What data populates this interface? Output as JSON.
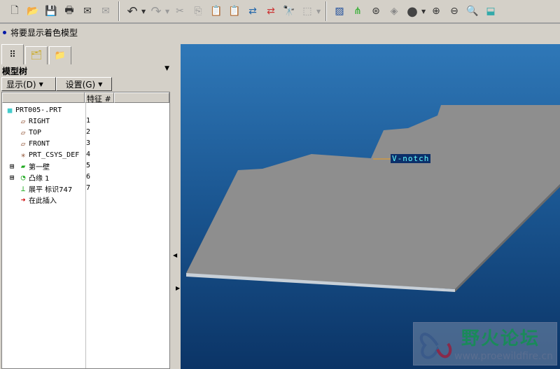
{
  "toolbar": {
    "icons": [
      "new-icon",
      "open-icon",
      "save-icon",
      "print-icon",
      "email-icon",
      "email-link-icon",
      "undo-icon",
      "redo-icon",
      "cut-icon",
      "copy-icon",
      "paste-icon",
      "paste-special-icon",
      "regenerate-icon",
      "regen-manager-icon",
      "find-icon",
      "select-box-icon",
      "datum-display-icon",
      "axis-icon",
      "csys-icon",
      "spin-icon",
      "shading-icon",
      "zoom-in-icon",
      "zoom-out-icon",
      "refit-icon",
      "reorient-icon"
    ]
  },
  "message": "将要显示着色模型",
  "panel": {
    "title": "模型树",
    "show_label": "显示(D)",
    "settings_label": "设置(G)",
    "col_feature": "特征 #"
  },
  "tree": [
    {
      "label": "PRT005-.PRT",
      "num": ""
    },
    {
      "label": "RIGHT",
      "num": "1"
    },
    {
      "label": "TOP",
      "num": "2"
    },
    {
      "label": "FRONT",
      "num": "3"
    },
    {
      "label": "PRT_CSYS_DEF",
      "num": "4"
    },
    {
      "label": "第一壁",
      "num": "5"
    },
    {
      "label": "凸缘 1",
      "num": "6"
    },
    {
      "label": "展平 标识747",
      "num": "7"
    },
    {
      "label": "在此插入",
      "num": ""
    }
  ],
  "viewport": {
    "annotation": "V-notch",
    "watermark_title": "野火论坛",
    "watermark_url": "www.proewildfire.cn"
  }
}
